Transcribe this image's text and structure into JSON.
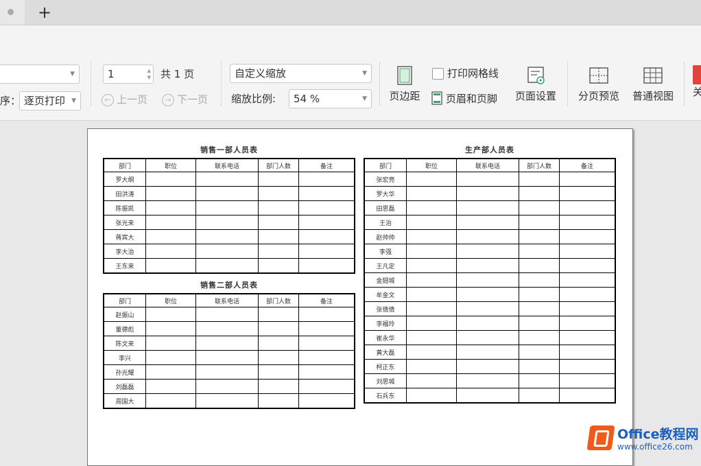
{
  "tabbar": {
    "add_label": "+"
  },
  "toolbar": {
    "order_label": "序：",
    "order_value": "逐页打印",
    "page_input": "1",
    "total_pages": "共 1 页",
    "prev_page": "上一页",
    "next_page": "下一页",
    "zoom_mode": "自定义缩放",
    "zoom_ratio_label": "缩放比例:",
    "zoom_value": "54 %",
    "margin_btn": "页边距",
    "print_grid_label": "打印网格线",
    "header_footer_btn": "页眉和页脚",
    "page_setup_btn": "页面设置",
    "page_break_preview_btn": "分页预览",
    "normal_view_btn": "普通视图",
    "close_partial": "关"
  },
  "document": {
    "headers": [
      "部门",
      "职位",
      "联系电话",
      "部门人数",
      "备注"
    ],
    "tables": [
      {
        "title": "销售一部人员表",
        "names": [
          "罗大纲",
          "田洪涛",
          "陈振凯",
          "张光来",
          "蒋宾大",
          "李大治",
          "王东来"
        ]
      },
      {
        "title": "销售二部人员表",
        "names": [
          "赵振山",
          "董德彪",
          "陈文来",
          "李兴",
          "孙光耀",
          "刘磊磊",
          "周国大"
        ]
      },
      {
        "title": "生产部人员表",
        "names": [
          "张宏亮",
          "罗大华",
          "田思磊",
          "王治",
          "赵帅帅",
          "李强",
          "王凡定",
          "金翅城",
          "牟金文",
          "张倩倩",
          "李福玲",
          "崔永华",
          "黄大磊",
          "柯正东",
          "刘思城",
          "石兵东"
        ]
      }
    ]
  },
  "watermark": {
    "title": "Office教程网",
    "url": "www.office26.com"
  },
  "colors": {
    "watermark_orange": "#f05a1a",
    "watermark_blue": "#1c5fbf"
  }
}
